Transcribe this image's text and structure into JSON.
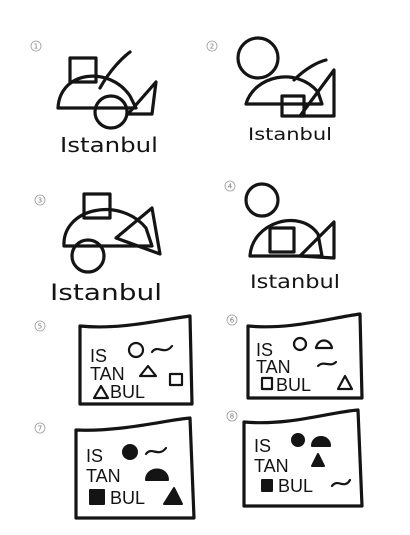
{
  "sketches": [
    {
      "number": "1",
      "lines": [
        "Istanbul"
      ]
    },
    {
      "number": "2",
      "lines": [
        "Istanbul"
      ]
    },
    {
      "number": "3",
      "lines": [
        "Istanbul"
      ]
    },
    {
      "number": "4",
      "lines": [
        "Istanbul"
      ]
    },
    {
      "number": "5",
      "lines": [
        "IS",
        "TAN",
        "BUL"
      ]
    },
    {
      "number": "6",
      "lines": [
        "IS",
        "TAN",
        "BUL"
      ]
    },
    {
      "number": "7",
      "lines": [
        "IS",
        "TAN",
        "BUL"
      ]
    },
    {
      "number": "8",
      "lines": [
        "IS",
        "TAN",
        "BUL"
      ]
    }
  ]
}
